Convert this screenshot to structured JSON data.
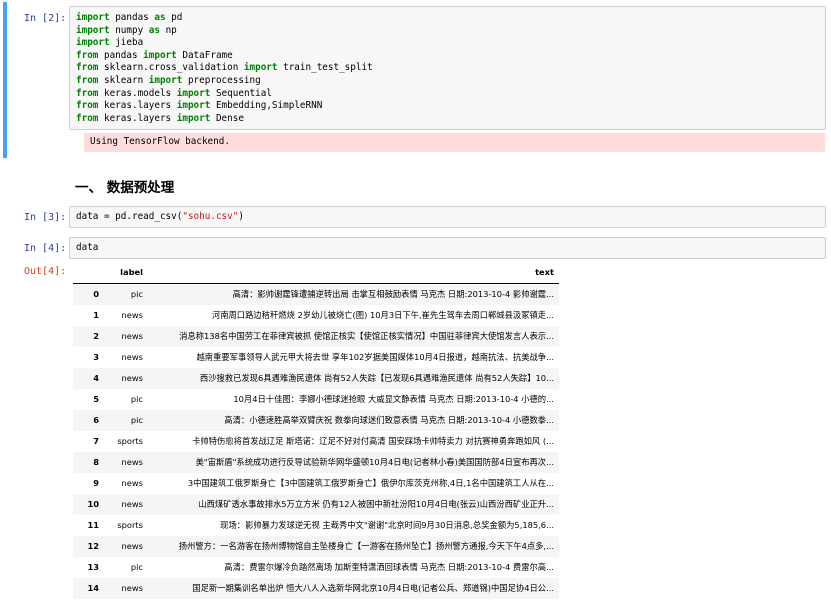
{
  "cell2": {
    "prompt": "In  [2]:",
    "code": [
      [
        {
          "t": "import",
          "k": 1
        },
        {
          "t": " pandas "
        },
        {
          "t": "as",
          "k": 1
        },
        {
          "t": " pd"
        }
      ],
      [
        {
          "t": "import",
          "k": 1
        },
        {
          "t": " numpy "
        },
        {
          "t": "as",
          "k": 1
        },
        {
          "t": " np"
        }
      ],
      [
        {
          "t": "import",
          "k": 1
        },
        {
          "t": " jieba"
        }
      ],
      [
        {
          "t": "from",
          "k": 1
        },
        {
          "t": " pandas "
        },
        {
          "t": "import",
          "k": 1
        },
        {
          "t": " DataFrame"
        }
      ],
      [
        {
          "t": "from",
          "k": 1
        },
        {
          "t": " sklearn.cross_validation "
        },
        {
          "t": "import",
          "k": 1
        },
        {
          "t": " train_test_split"
        }
      ],
      [
        {
          "t": "from",
          "k": 1
        },
        {
          "t": " sklearn "
        },
        {
          "t": "import",
          "k": 1
        },
        {
          "t": " preprocessing"
        }
      ],
      [
        {
          "t": "from",
          "k": 1
        },
        {
          "t": " keras.models "
        },
        {
          "t": "import",
          "k": 1
        },
        {
          "t": " Sequential"
        }
      ],
      [
        {
          "t": "from",
          "k": 1
        },
        {
          "t": " keras.layers "
        },
        {
          "t": "import",
          "k": 1
        },
        {
          "t": " Embedding,SimpleRNN"
        }
      ],
      [
        {
          "t": "from",
          "k": 1
        },
        {
          "t": " keras.layers "
        },
        {
          "t": "import",
          "k": 1
        },
        {
          "t": " Dense"
        }
      ]
    ],
    "stderr": "Using TensorFlow backend."
  },
  "heading": "一、 数据预处理",
  "cell3": {
    "prompt": "In  [3]:",
    "code_pre": "data = pd.read_csv(",
    "code_str": "\"sohu.csv\"",
    "code_post": ")"
  },
  "cell4": {
    "prompt": "In  [4]:",
    "code": "data",
    "out_prompt": "Out[4]:"
  },
  "dataframe": {
    "columns": [
      "",
      "label",
      "text"
    ],
    "rows": [
      [
        "0",
        "pic",
        "高清：影帅谢霆锋遭捕逆转出局 击掌互相鼓励表情 马克杰 日期:2013-10-4 影帅谢霆..."
      ],
      [
        "1",
        "news",
        "河南周口路边秸秆燃烧 2岁幼儿被烧亡(图) 10月3日下午,崔先生驾车去周口郸城县汲冢镇走..."
      ],
      [
        "2",
        "news",
        "消息称138名中国劳工在菲律宾被抓 使馆正核实【使馆正核实情况】中国驻菲律宾大使馆发言人表示..."
      ],
      [
        "3",
        "news",
        "越南重要军事领导人武元甲大将去世 享年102岁据美国媒体10月4日报道，越南抗法、抗美战争..."
      ],
      [
        "4",
        "news",
        "西沙搜救已发现6具遇难渔民遗体 尚有52人失踪【已发现6具遇难渔民遗体 尚有52人失踪】10..."
      ],
      [
        "5",
        "pic",
        "10月4日十佳图：李娜小德球迷抢眼 大威显文静表情 马克杰 日期:2013-10-4 小德的..."
      ],
      [
        "6",
        "pic",
        "高清：小德速胜高举双臂庆祝 数拳向球迷们致意表情 马克杰 日期:2013-10-4 小德数拳..."
      ],
      [
        "7",
        "sports",
        "卡帅特伤愈将首发战辽足 斯塔诺：辽足不好对付高清 国安踩场卡帅特卖力 对抗赛神勇奔跑如风 (..."
      ],
      [
        "8",
        "news",
        "美\"宙斯盾\"系统成功进行反导试验新华网华盛顿10月4日电(记者林小春)美国国防部4日宣布再次..."
      ],
      [
        "9",
        "news",
        "3中国建筑工俄罗斯身亡【3中国建筑工俄罗斯身亡】俄伊尔库茨克州称,4日,1名中国建筑工人从在..."
      ],
      [
        "10",
        "news",
        "山西煤矿透水事故排水5万立方米 仍有12人被困中新社汾阳10月4日电(张云)山西汾西矿业正升..."
      ],
      [
        "11",
        "sports",
        "现场：影帅暴力发球逆无视 主裁秀中文\"谢谢\"北京时间9月30日消息,总奖金额为5,185,6..."
      ],
      [
        "12",
        "news",
        "扬州警方：一名游客在扬州博物馆自主坠楼身亡【一游客在扬州坠亡】扬州警方通报,今天下午4点多,..."
      ],
      [
        "13",
        "pic",
        "高清：费雷尔爆冷负踏然离场 加斯奎特潇洒回球表情 马克杰 日期:2013-10-4 费雷尔高..."
      ],
      [
        "14",
        "news",
        "国足新一期集训名单出炉 恒大八人入选新华网北京10月4日电(记者公兵、郑道锦)中国足协4日公..."
      ]
    ]
  }
}
